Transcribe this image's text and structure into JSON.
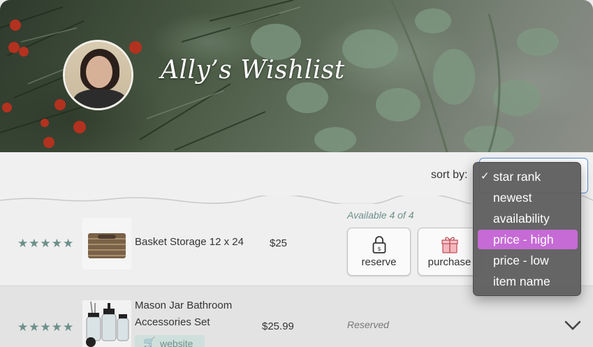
{
  "header": {
    "title": "Ally’s Wishlist"
  },
  "sort": {
    "label": "sort by:",
    "options": [
      "star rank",
      "newest",
      "availability",
      "price - high",
      "price - low",
      "item name"
    ],
    "checked": "star rank",
    "highlighted": "price - high",
    "highlight_color": "#c66ad5"
  },
  "items": [
    {
      "stars": "★★★★★",
      "name": "Basket Storage 12 x 24",
      "price": "$25",
      "availability": "Available 4 of 4",
      "actions": {
        "reserve": "reserve",
        "purchase": "purchase"
      },
      "icons": {
        "reserve": "lock-icon",
        "purchase": "gift-icon"
      }
    },
    {
      "stars": "★★★★★",
      "name_line1": "Mason Jar Bathroom",
      "name_line2": "Accessories Set",
      "price": "$25.99",
      "status": "Reserved",
      "website_label": "website",
      "icons": {
        "website": "cart-icon",
        "expand": "chevron-down-icon"
      }
    }
  ],
  "colors": {
    "accent_teal": "#6c8f8a",
    "select_border": "#5a8ee0",
    "dropdown_bg": "#606060"
  }
}
